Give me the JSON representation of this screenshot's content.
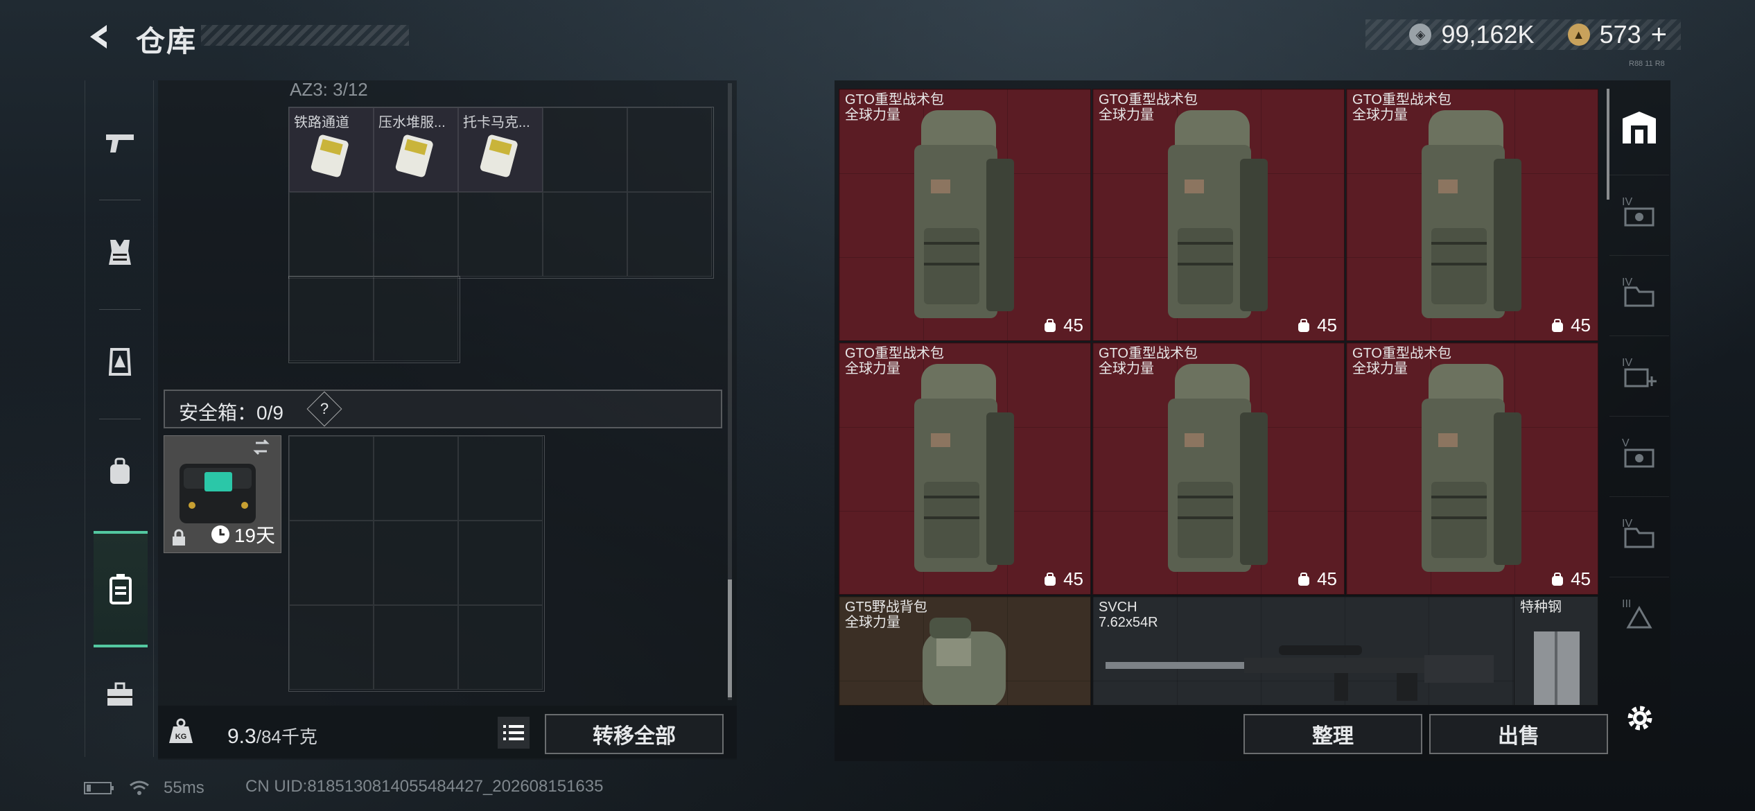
{
  "header": {
    "title": "仓库",
    "currency": [
      {
        "icon": "silver-coin-icon",
        "value": "99,162K",
        "color": "#c9ced3"
      },
      {
        "icon": "gold-coin-icon",
        "value": "573",
        "plus": "+",
        "color": "#c8a25c"
      }
    ],
    "mini_label": "R88 11 R8"
  },
  "left_rail": {
    "items": [
      {
        "name": "weapons",
        "icon": "pistol-icon"
      },
      {
        "name": "armor",
        "icon": "vest-icon"
      },
      {
        "name": "chest-rig",
        "icon": "rig-icon"
      },
      {
        "name": "backpack",
        "icon": "backpack-icon"
      },
      {
        "name": "safebox",
        "icon": "case-icon",
        "active": true
      },
      {
        "name": "toolbox",
        "icon": "toolbox-icon"
      }
    ]
  },
  "backpack_section": {
    "label": "AZ3: 3/12",
    "items": [
      {
        "name": "铁路通道",
        "icon": "keycard-icon"
      },
      {
        "name": "压水堆服...",
        "icon": "keycard-icon"
      },
      {
        "name": "托卡马克...",
        "icon": "keycard-icon"
      }
    ]
  },
  "safebox": {
    "label": "安全箱：0/9",
    "help": "?",
    "item_days": "19天"
  },
  "weight": {
    "current": "9.3",
    "max": "/84千克",
    "icon": "kg-weight-icon"
  },
  "buttons": {
    "transfer_all": "转移全部",
    "sort": "整理",
    "sell": "出售"
  },
  "storage": {
    "items": [
      {
        "name": "GTO重型战术包",
        "sub": "全球力量",
        "count": "45"
      },
      {
        "name": "GTO重型战术包",
        "sub": "全球力量",
        "count": "45"
      },
      {
        "name": "GTO重型战术包",
        "sub": "全球力量",
        "count": "45"
      },
      {
        "name": "GTO重型战术包",
        "sub": "全球力量",
        "count": "45"
      },
      {
        "name": "GTO重型战术包",
        "sub": "全球力量",
        "count": "45"
      },
      {
        "name": "GTO重型战术包",
        "sub": "全球力量",
        "count": "45"
      },
      {
        "name": "GT5野战背包",
        "sub": "全球力量"
      },
      {
        "name": "SVCH",
        "sub": "7.62x54R"
      },
      {
        "name": "特种钢",
        "sub": ""
      }
    ]
  },
  "right_rail": {
    "items": [
      "IV",
      "IV",
      "IV",
      "V",
      "IV",
      "III"
    ]
  },
  "status": {
    "ping": "55ms",
    "uid": "CN UID:8185130814055484427_202608151635"
  },
  "colors": {
    "accent": "#53c8a0",
    "tile_red": "#5b1c24",
    "tile_brown": "#3b2f25"
  }
}
